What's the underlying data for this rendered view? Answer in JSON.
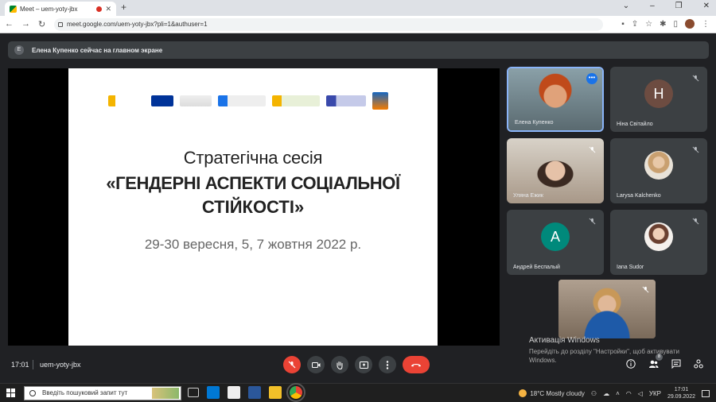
{
  "browser": {
    "tab_title": "Meet – uem-yoty-jbx",
    "url": "meet.google.com/uem-yoty-jbx?pli=1&authuser=1"
  },
  "banner": {
    "initial": "Е",
    "text": "Елена Купенко сейчас на главном экране"
  },
  "slide": {
    "title_line1": "Стратегічна сесія",
    "title_line2": "«ГЕНДЕРНІ АСПЕКТИ СОЦІАЛЬНОЇ",
    "title_line3": "СТІЙКОСТІ»",
    "dates": "29-30 вересня, 5, 7 жовтня 2022 р."
  },
  "participants": [
    {
      "name": "Елена Купенко",
      "initial": "",
      "avatar_color": ""
    },
    {
      "name": "Ніна Світайло",
      "initial": "Н",
      "avatar_color": "#6d4c41"
    },
    {
      "name": "Уляна Ежик",
      "initial": "",
      "avatar_color": ""
    },
    {
      "name": "Larysa Kalchenko",
      "initial": "",
      "avatar_color": ""
    },
    {
      "name": "Андрей Беспалый",
      "initial": "А",
      "avatar_color": "#00897b"
    },
    {
      "name": "Iana Sudor",
      "initial": "",
      "avatar_color": ""
    }
  ],
  "watermark": {
    "title": "Активація Windows",
    "text": "Перейдіть до розділу \"Настройки\", щоб активувати Windows."
  },
  "meeting": {
    "time": "17:01",
    "code": "uem-yoty-jbx",
    "people_badge": "8"
  },
  "taskbar": {
    "search_placeholder": "Введіть пошуковий запит тут",
    "weather": "18°C  Mostly cloudy",
    "lang": "УКР",
    "clock_time": "17:01",
    "clock_date": "29.09.2022"
  },
  "colors": {
    "meet_bg": "#202124",
    "tile_bg": "#3c4043",
    "end_call": "#ea4335",
    "active_speaker": "#8ab4f8"
  }
}
